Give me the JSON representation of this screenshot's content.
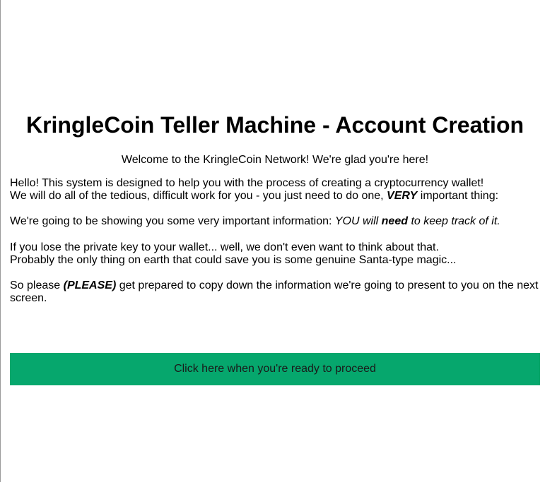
{
  "page": {
    "title": "KringleCoin Teller Machine - Account Creation",
    "welcome": "Welcome to the KringleCoin Network! We're glad you're here!"
  },
  "paragraphs": {
    "p1_line1": "Hello! This system is designed to help you with the process of creating a cryptocurrency wallet!",
    "p1_line2_pre": "We will do all of the tedious, difficult work for you - you just need to do one, ",
    "p1_line2_em": "VERY",
    "p1_line2_post": " important thing:",
    "p2_pre": "We're going to be showing you some very important information: ",
    "p2_em_pre": "YOU will ",
    "p2_em_strong": "need",
    "p2_em_post": " to keep track of it.",
    "p3_line1": "If you lose the private key to your wallet... well, we don't even want to think about that.",
    "p3_line2": "Probably the only thing on earth that could save you is some genuine Santa-type magic...",
    "p4_pre": "So please ",
    "p4_em": "(PLEASE)",
    "p4_post": " get prepared to copy down the information we're going to present to you on the next screen."
  },
  "proceed_button": {
    "label": "Click here when you're ready to proceed",
    "color": "#06a76d"
  }
}
